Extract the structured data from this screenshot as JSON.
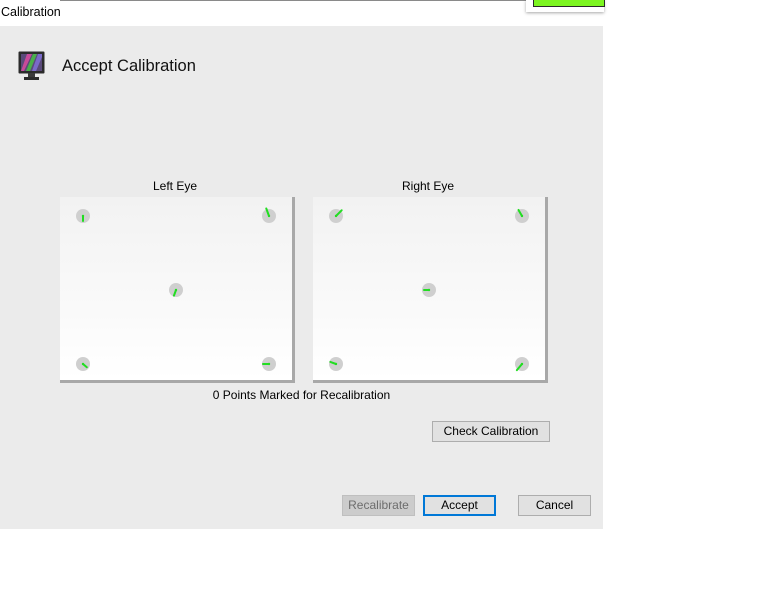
{
  "window": {
    "title": "Calibration"
  },
  "header": {
    "heading": "Accept Calibration",
    "icon": "monitor-icon"
  },
  "left_eye": {
    "label": "Left Eye",
    "points": [
      {
        "id": "top-left",
        "marker_angle": 90,
        "marker_len": 5
      },
      {
        "id": "top-right",
        "marker_angle": -110,
        "marker_len": 8
      },
      {
        "id": "center",
        "marker_angle": 110,
        "marker_len": 6
      },
      {
        "id": "bottom-left",
        "marker_angle": 40,
        "marker_len": 5
      },
      {
        "id": "bottom-right",
        "marker_angle": 180,
        "marker_len": 6
      }
    ]
  },
  "right_eye": {
    "label": "Right Eye",
    "points": [
      {
        "id": "top-left",
        "marker_angle": -45,
        "marker_len": 8
      },
      {
        "id": "top-right",
        "marker_angle": -120,
        "marker_len": 7
      },
      {
        "id": "center",
        "marker_angle": 180,
        "marker_len": 5
      },
      {
        "id": "bottom-left",
        "marker_angle": -160,
        "marker_len": 6
      },
      {
        "id": "bottom-right",
        "marker_angle": 130,
        "marker_len": 8
      }
    ]
  },
  "status": {
    "points_marked": "0 Points Marked for Recalibration"
  },
  "buttons": {
    "check_calibration": "Check Calibration",
    "recalibrate": "Recalibrate",
    "accept": "Accept",
    "cancel": "Cancel"
  },
  "colors": {
    "marker": "#22dd22",
    "dot": "#cfcfcf",
    "dialog_bg": "#ebebeb",
    "accent": "#0078d7",
    "bg_window_bar": "#7cf520"
  }
}
